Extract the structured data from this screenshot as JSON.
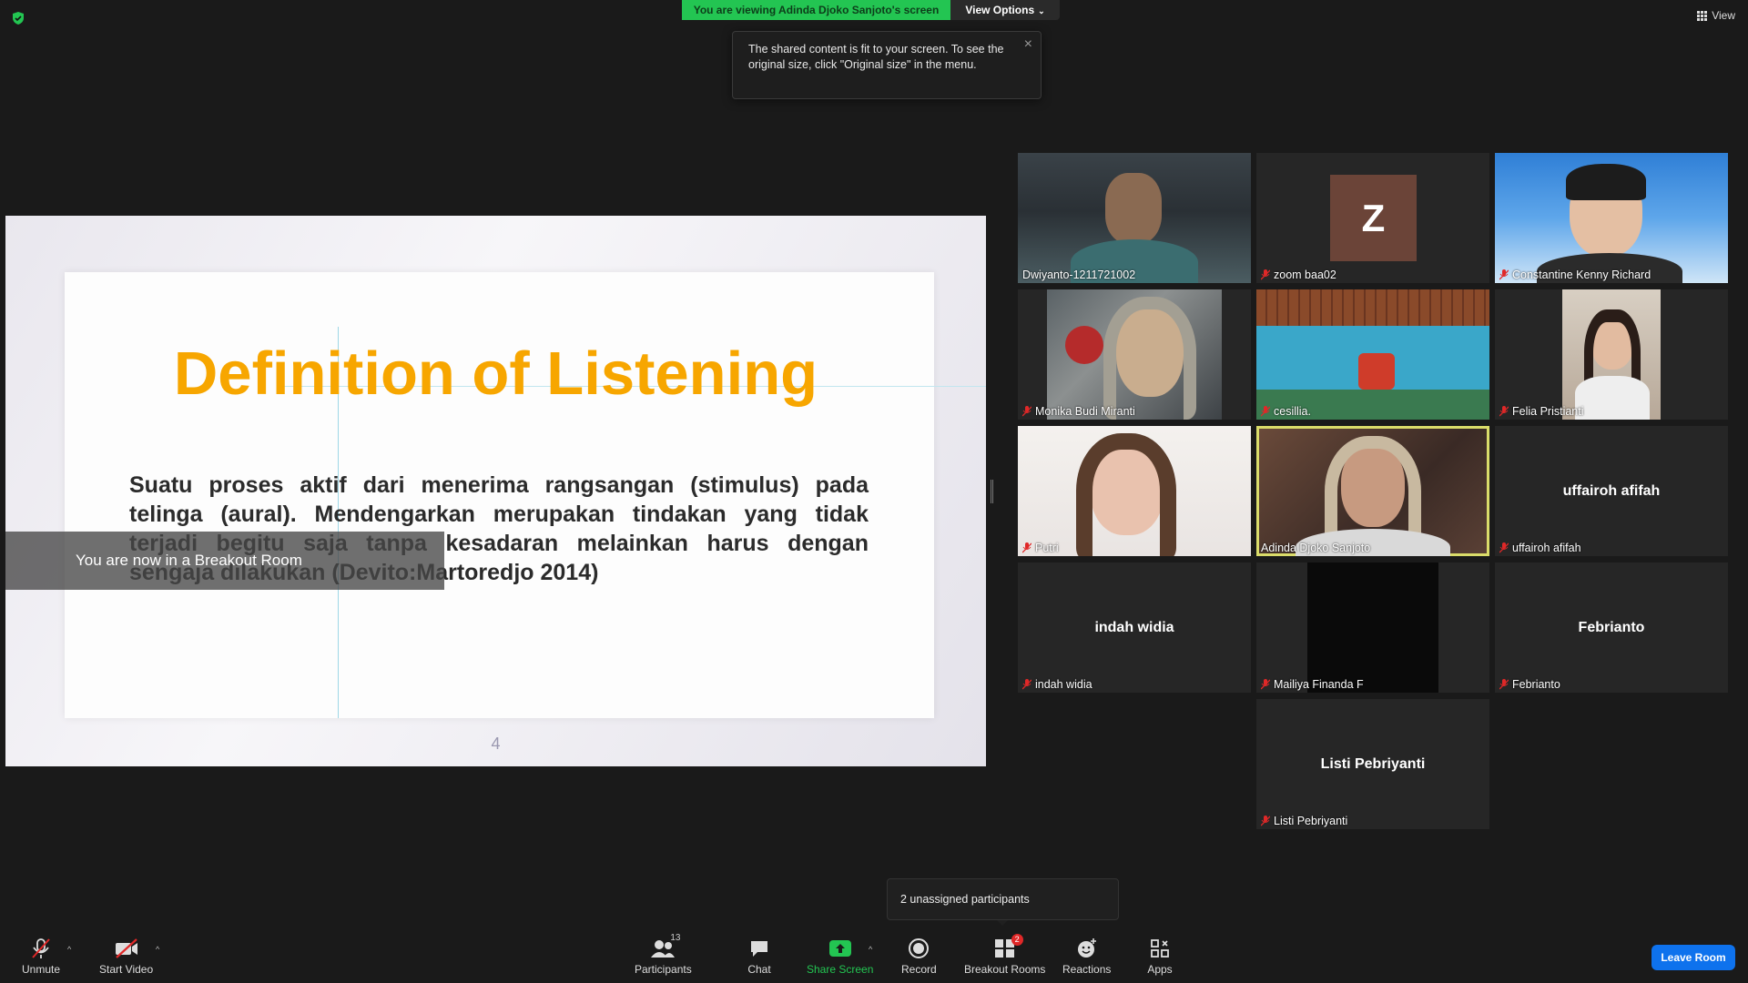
{
  "banner": {
    "viewing": "You are viewing Adinda Djoko Sanjoto's screen",
    "view_options": "View Options"
  },
  "top_right": {
    "view": "View"
  },
  "tooltip": {
    "text": "The shared content is fit to your screen. To see the original size, click \"Original size\" in the menu."
  },
  "slide": {
    "title": "Definition of Listening",
    "body": "Suatu proses aktif dari menerima rangsangan (stimulus) pada telinga (aural). Mendengarkan merupakan tindakan yang tidak terjadi begitu saja tanpa kesadaran melainkan harus dengan sengaja dilakukan (Devito:Martoredjo 2014)",
    "page_number": "4",
    "title_color": "#f7a600"
  },
  "notice": {
    "breakout": "You are now in a Breakout Room"
  },
  "participants": [
    {
      "name": "Dwiyanto-1211721002",
      "muted": false
    },
    {
      "name": "zoom baa02",
      "muted": true,
      "avatar_letter": "Z"
    },
    {
      "name": "Constantine Kenny Richard",
      "muted": true
    },
    {
      "name": "Monika Budi Miranti",
      "muted": true
    },
    {
      "name": "cesillia.",
      "muted": true
    },
    {
      "name": "Felia Pristianti",
      "muted": true
    },
    {
      "name": "Putri",
      "muted": true
    },
    {
      "name": "Adinda Djoko Sanjoto",
      "muted": false,
      "active_speaker": true
    },
    {
      "name": "uffairoh afifah",
      "muted": true,
      "display": "uffairoh afifah"
    },
    {
      "name": "indah widia",
      "muted": true,
      "display": "indah widia"
    },
    {
      "name": "Mailiya Finanda F",
      "muted": true
    },
    {
      "name": "Febrianto",
      "muted": true,
      "display": "Febrianto"
    },
    {
      "name": "Listi Pebriyanti",
      "muted": true,
      "display": "Listi Pebriyanti"
    }
  ],
  "popover": {
    "unassigned": "2 unassigned participants"
  },
  "toolbar": {
    "unmute": "Unmute",
    "start_video": "Start Video",
    "participants": "Participants",
    "participants_count": "13",
    "chat": "Chat",
    "share_screen": "Share Screen",
    "record": "Record",
    "breakout_rooms": "Breakout Rooms",
    "breakout_badge": "2",
    "reactions": "Reactions",
    "apps": "Apps",
    "leave_room": "Leave Room"
  },
  "colors": {
    "accent_green": "#23c552",
    "leave_blue": "#0e72ed",
    "active_outline": "#dadc6a",
    "mute_red": "#e02828"
  }
}
